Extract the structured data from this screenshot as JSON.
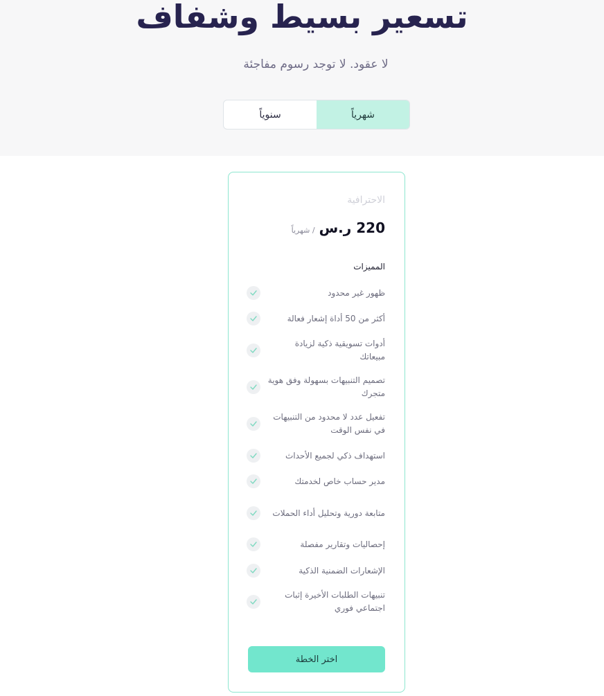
{
  "header": {
    "title": "تسعير بسيط وشفاف",
    "subtitle": "لا عقود. لا توجد رسوم مفاجئة"
  },
  "billing_toggle": {
    "monthly_label": "شهرياً",
    "yearly_label": "سنوياً",
    "selected": "monthly"
  },
  "plan": {
    "name": "الاحترافية",
    "price": "220 ر.س",
    "period": "/ شهرياً",
    "features_heading": "المميزات",
    "features": [
      "ظهور غير محدود",
      "أكثر من 50 أداة إشعار فعالة",
      "أدوات تسويقية ذكية لزيادة مبيعاتك",
      "تصميم التنبيهات بسهولة وفق هوية متجرك",
      "تفعيل عدد لا محدود من التنبيهات في نفس الوقت",
      "استهداف ذكي لجميع الأحداث",
      "مدير حساب خاص لخدمتك",
      "متابعة دورية وتحليل أداء الحملات",
      "إحصاليات وتقارير مفصلة",
      "الإشعارات الضمنية الذكية",
      "تنبيهات الطلبات الأخيرة إثبات اجتماعي فوري"
    ],
    "cta_label": "اختر الخطة"
  },
  "colors": {
    "accent": "#72e6cd",
    "accent_light": "#c2f2e4",
    "title": "#27234f"
  }
}
